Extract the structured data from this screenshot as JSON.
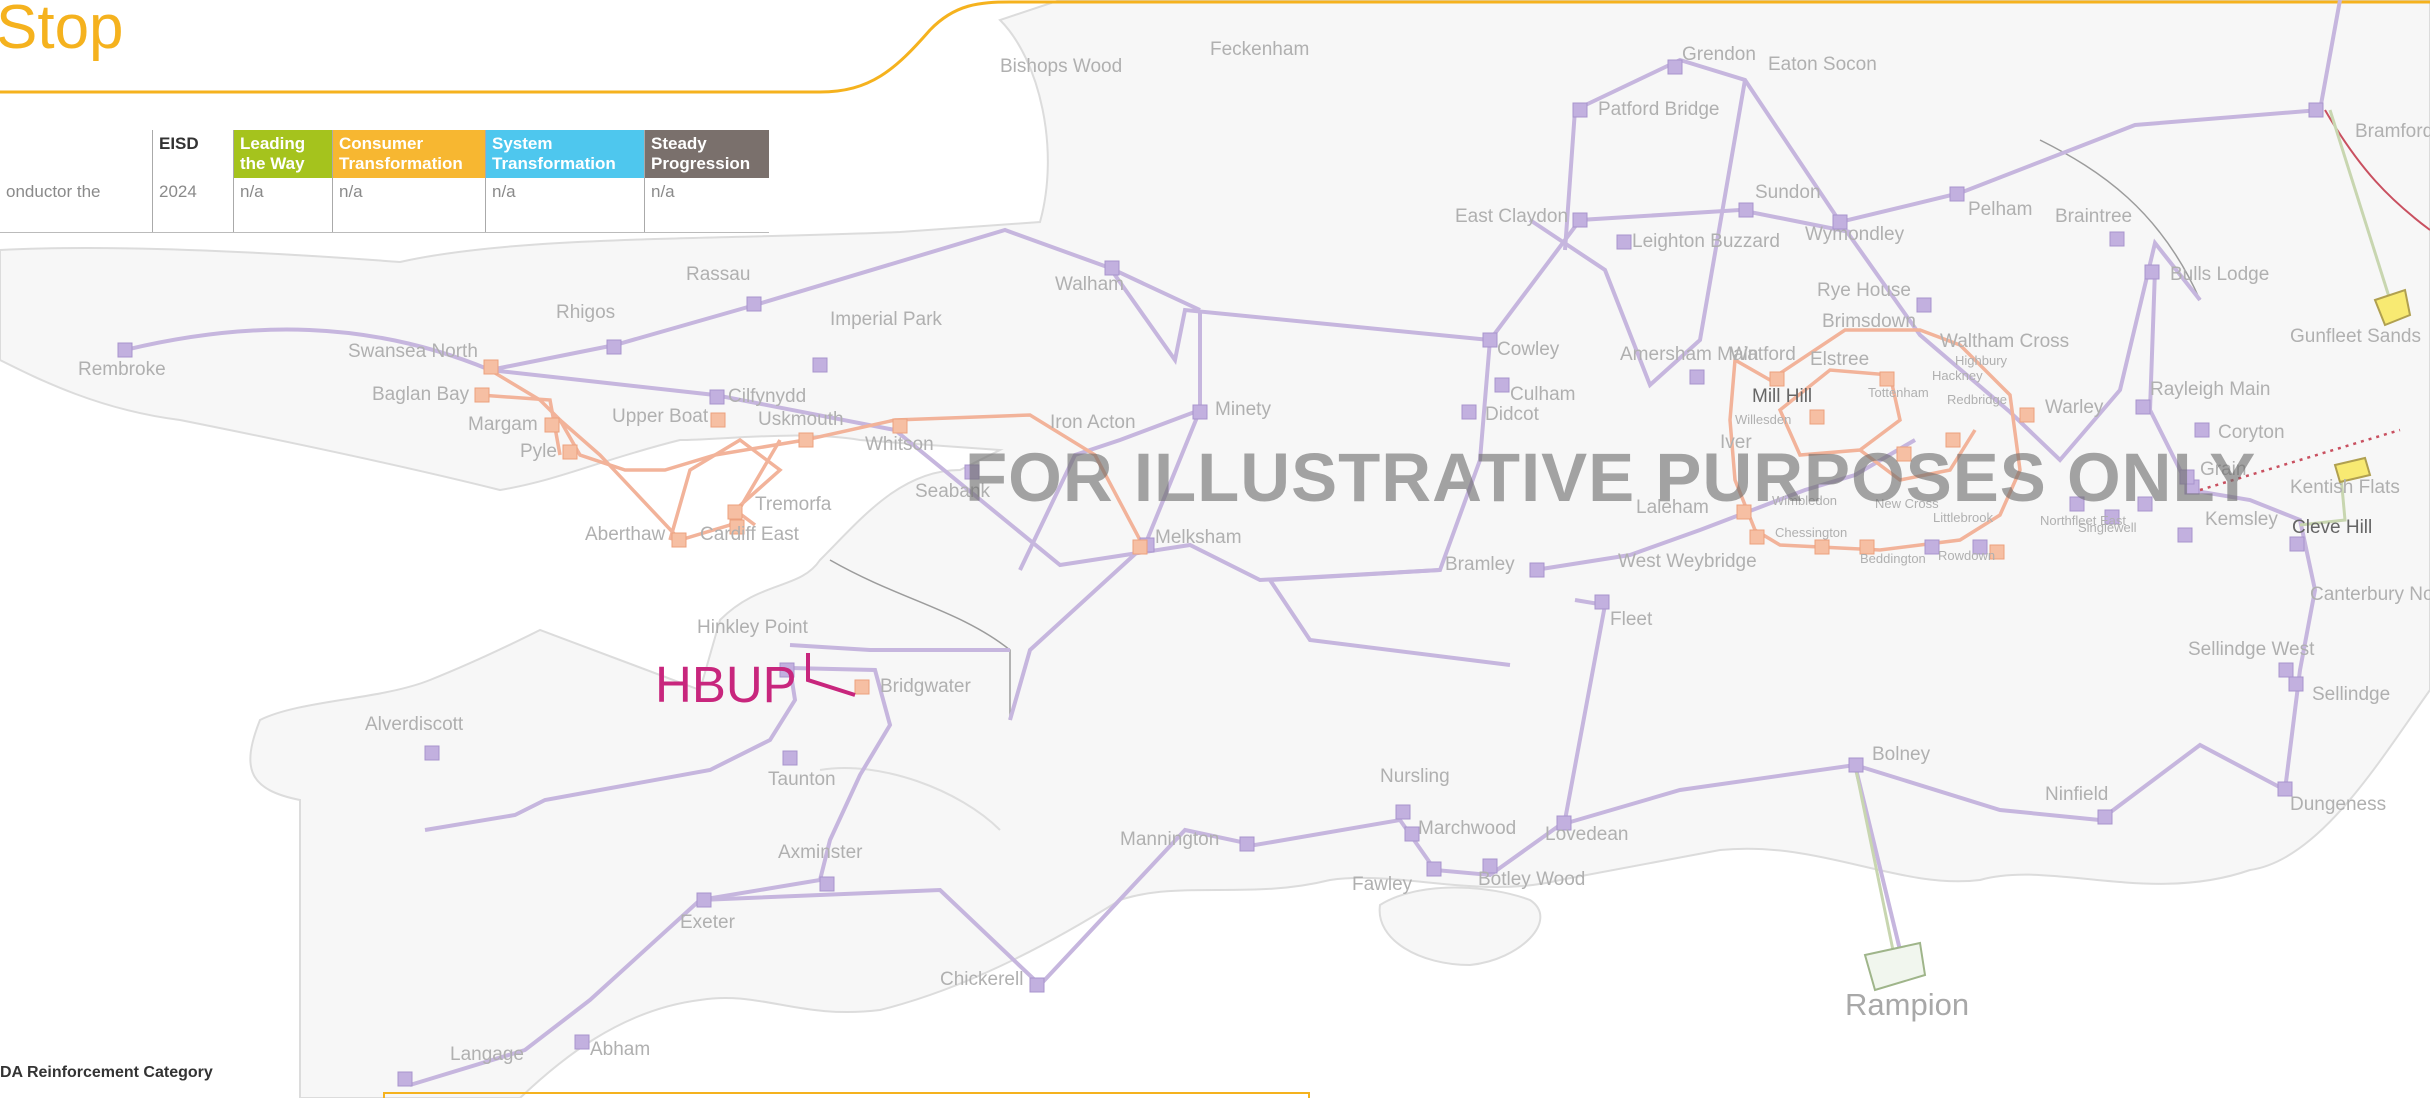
{
  "header": {
    "title": "Stop"
  },
  "options_table": {
    "columns": [
      "",
      "EISD",
      "Leading the Way",
      "Consumer Transformation",
      "System Transformation",
      "Steady Progression"
    ],
    "column_colors": [
      "#ffffff",
      "#ffffff",
      "#a5c31d",
      "#f7b731",
      "#4ec7ee",
      "#7a706c"
    ],
    "row": [
      "onductor the",
      "2024",
      "n/a",
      "n/a",
      "n/a",
      "n/a"
    ]
  },
  "watermark": "FOR ILLUSTRATIVE PURPOSES ONLY",
  "highlight": {
    "label": "HBUP",
    "color": "#c8267d"
  },
  "legend_caption": "DA Reinforcement Category",
  "colors": {
    "accent": "#f5b21e",
    "network_line": "#c3b4dc",
    "substation": "#bba7da",
    "highlighted_network": "#f4a882",
    "label": "#b0b0b0"
  },
  "map": {
    "substations": [
      {
        "name": "Bishops Wood"
      },
      {
        "name": "Feckenham"
      },
      {
        "name": "Grendon"
      },
      {
        "name": "Eaton Socon"
      },
      {
        "name": "Patford Bridge"
      },
      {
        "name": "East Claydon"
      },
      {
        "name": "Leighton Buzzard"
      },
      {
        "name": "Sundon"
      },
      {
        "name": "Wymondley"
      },
      {
        "name": "Pelham"
      },
      {
        "name": "Braintree"
      },
      {
        "name": "Bramford"
      },
      {
        "name": "Bulls Lodge"
      },
      {
        "name": "Gunfleet Sands"
      },
      {
        "name": "Rye House"
      },
      {
        "name": "Brimsdown"
      },
      {
        "name": "Waltham Cross"
      },
      {
        "name": "Highbury"
      },
      {
        "name": "Hackney"
      },
      {
        "name": "Tottenham"
      },
      {
        "name": "Redbridge"
      },
      {
        "name": "Warley"
      },
      {
        "name": "Rayleigh Main"
      },
      {
        "name": "Coryton"
      },
      {
        "name": "Grain"
      },
      {
        "name": "Kentish Flats"
      },
      {
        "name": "Kemsley"
      },
      {
        "name": "Cleve Hill"
      },
      {
        "name": "Canterbury North"
      },
      {
        "name": "Sellindge West"
      },
      {
        "name": "Sellindge"
      },
      {
        "name": "Dungeness"
      },
      {
        "name": "Ninfield"
      },
      {
        "name": "Bolney"
      },
      {
        "name": "Rampion"
      },
      {
        "name": "Rembroke"
      },
      {
        "name": "Swansea North"
      },
      {
        "name": "Baglan Bay"
      },
      {
        "name": "Margam"
      },
      {
        "name": "Pyle"
      },
      {
        "name": "Rhigos"
      },
      {
        "name": "Rassau"
      },
      {
        "name": "Imperial Park"
      },
      {
        "name": "Walham"
      },
      {
        "name": "Upper Boat"
      },
      {
        "name": "Cilfynydd"
      },
      {
        "name": "Uskmouth"
      },
      {
        "name": "Whitson"
      },
      {
        "name": "Iron Acton"
      },
      {
        "name": "Seabank"
      },
      {
        "name": "Minety"
      },
      {
        "name": "Melksham"
      },
      {
        "name": "Tremorfa"
      },
      {
        "name": "Aberthaw"
      },
      {
        "name": "Cardiff East"
      },
      {
        "name": "Cowley"
      },
      {
        "name": "Culham"
      },
      {
        "name": "Didcot"
      },
      {
        "name": "Amersham Main"
      },
      {
        "name": "Watford"
      },
      {
        "name": "Elstree"
      },
      {
        "name": "Mill Hill"
      },
      {
        "name": "Willesden"
      },
      {
        "name": "Iver"
      },
      {
        "name": "Laleham"
      },
      {
        "name": "Wimbledon"
      },
      {
        "name": "New Cross"
      },
      {
        "name": "Littlebrook"
      },
      {
        "name": "Northfleet East"
      },
      {
        "name": "Singlewell"
      },
      {
        "name": "Chessington"
      },
      {
        "name": "Beddington"
      },
      {
        "name": "Rowdown"
      },
      {
        "name": "West Weybridge"
      },
      {
        "name": "Bramley"
      },
      {
        "name": "Fleet"
      },
      {
        "name": "Hinkley Point"
      },
      {
        "name": "Bridgwater"
      },
      {
        "name": "Alverdiscott"
      },
      {
        "name": "Taunton"
      },
      {
        "name": "Axminster"
      },
      {
        "name": "Exeter"
      },
      {
        "name": "Mannington"
      },
      {
        "name": "Nursling"
      },
      {
        "name": "Marchwood"
      },
      {
        "name": "Lovedean"
      },
      {
        "name": "Fawley"
      },
      {
        "name": "Botley Wood"
      },
      {
        "name": "Chickerell"
      },
      {
        "name": "Abham"
      },
      {
        "name": "Langage"
      }
    ]
  }
}
